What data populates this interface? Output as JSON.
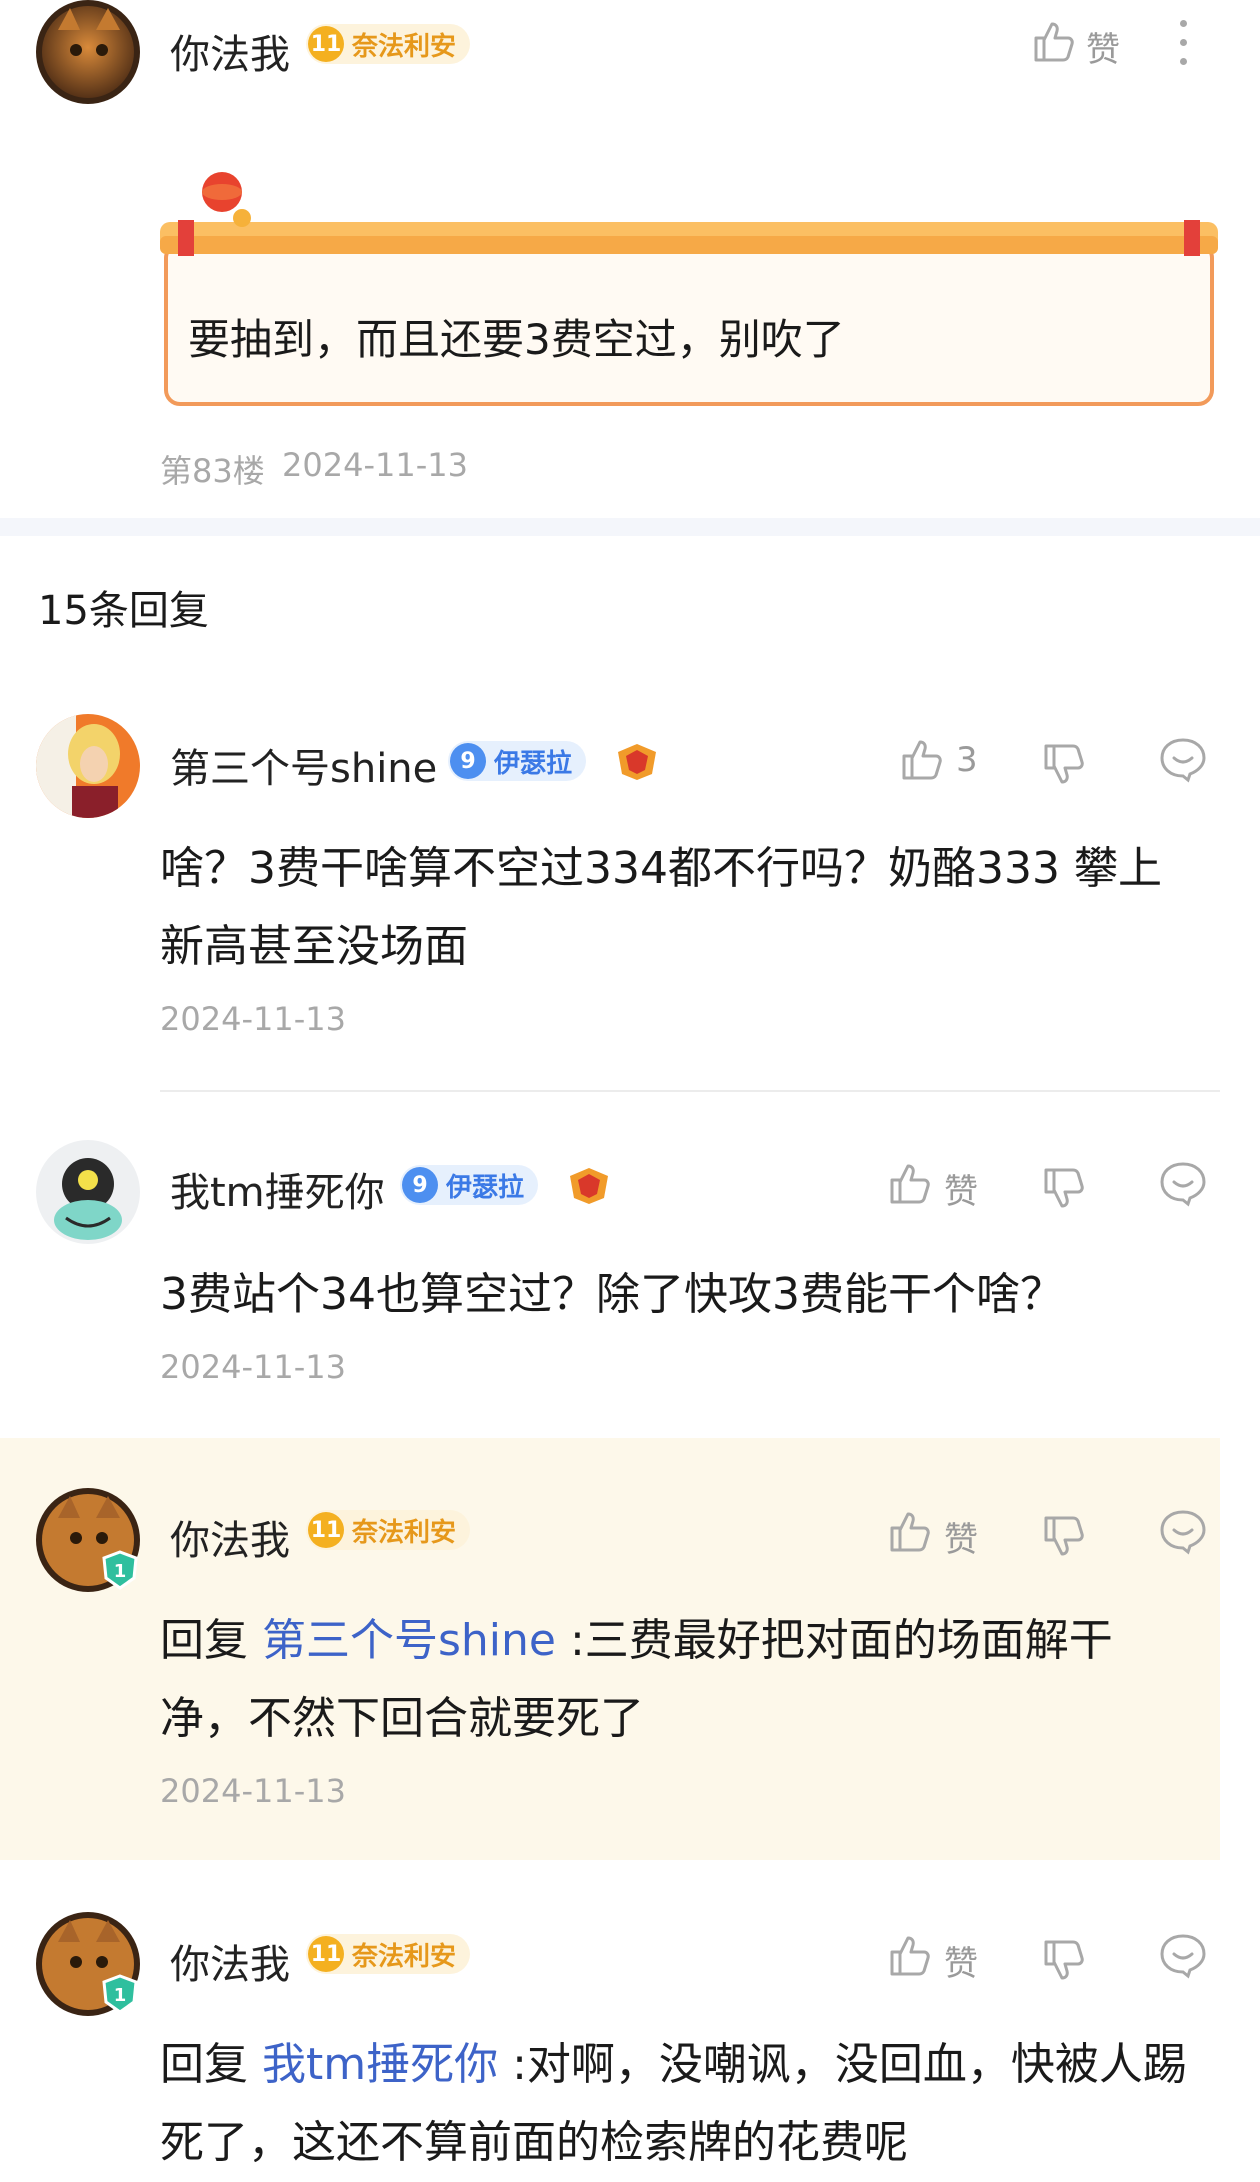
{
  "main_comment": {
    "username": "你法我",
    "badge_level": "11",
    "badge_name": "奈法利安",
    "like_label": "赞",
    "text": "要抽到，而且还要3费空过，别吹了",
    "floor": "第83楼",
    "date": "2024-11-13"
  },
  "replies_header": "15条回复",
  "replies": [
    {
      "username": "第三个号shine",
      "badge_level": "9",
      "badge_name": "伊瑟拉",
      "like_label": "3",
      "text": "啥？3费干啥算不空过334都不行吗？奶酪333 攀上新高甚至没场面",
      "date": "2024-11-13"
    },
    {
      "username": "我tm捶死你",
      "badge_level": "9",
      "badge_name": "伊瑟拉",
      "like_label": "赞",
      "text": "3费站个34也算空过？除了快攻3费能干个啥？",
      "date": "2024-11-13"
    },
    {
      "username": "你法我",
      "badge_level": "11",
      "badge_name": "奈法利安",
      "like_label": "赞",
      "reply_prefix": "回复 ",
      "reply_to": "第三个号shine",
      "text": " :三费最好把对面的场面解干净，不然下回合就要死了",
      "date": "2024-11-13"
    },
    {
      "username": "你法我",
      "badge_level": "11",
      "badge_name": "奈法利安",
      "like_label": "赞",
      "reply_prefix": "回复 ",
      "reply_to": "我tm捶死你",
      "text": " :对啊，没嘲讽，没回血，快被人踢死了，这还不算前面的检索牌的花费呢",
      "date": ""
    }
  ],
  "colors": {
    "mention": "#3d63c8",
    "gold_badge": "#f4b020",
    "blue_badge": "#4d8ff0",
    "highlight_bg": "#fdf8ea",
    "scroll_border": "#f29a5a"
  }
}
